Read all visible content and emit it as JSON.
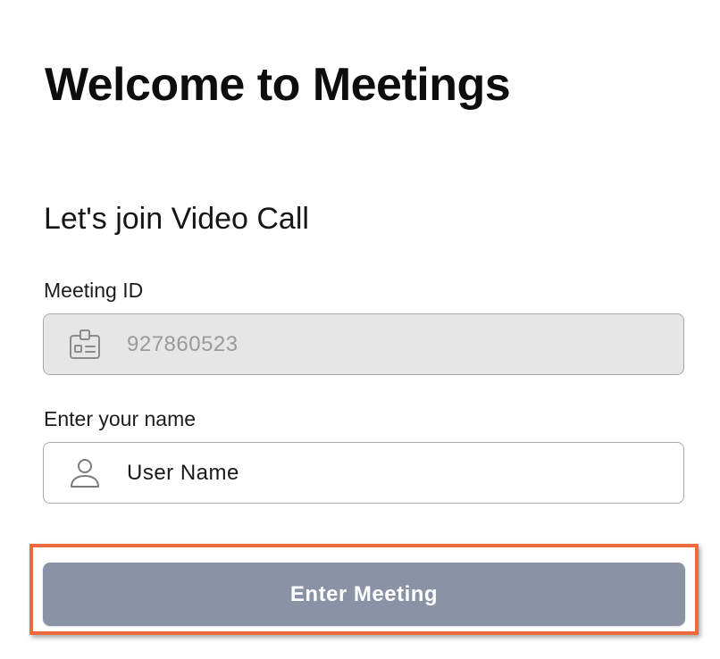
{
  "header": {
    "title": "Welcome to Meetings"
  },
  "form": {
    "subtitle": "Let's join Video Call",
    "meeting_id": {
      "label": "Meeting ID",
      "value": "927860523",
      "icon": "id-badge-icon",
      "disabled": true
    },
    "name": {
      "label": "Enter your name",
      "placeholder": "User Name",
      "icon": "user-icon"
    },
    "submit_label": "Enter Meeting"
  },
  "colors": {
    "button_bg": "#8a93a5",
    "highlight_border": "#ee6a3c",
    "disabled_field_bg": "#e6e6e6",
    "field_border": "#a8a8a8"
  }
}
